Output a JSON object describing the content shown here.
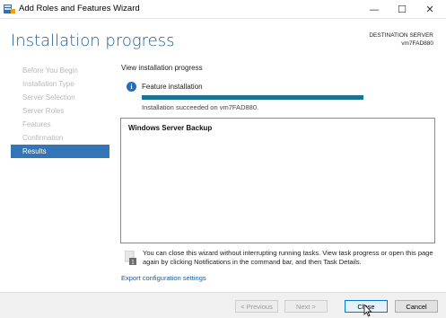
{
  "window": {
    "title": "Add Roles and Features Wizard",
    "controls": {
      "minimize": "—",
      "maximize": "☐",
      "close": "✕"
    }
  },
  "header": {
    "page_title": "Installation progress",
    "destination_label": "DESTINATION SERVER",
    "destination_server": "vm7FAD880"
  },
  "sidebar": {
    "items": [
      {
        "label": "Before You Begin",
        "active": false
      },
      {
        "label": "Installation Type",
        "active": false
      },
      {
        "label": "Server Selection",
        "active": false
      },
      {
        "label": "Server Roles",
        "active": false
      },
      {
        "label": "Features",
        "active": false
      },
      {
        "label": "Confirmation",
        "active": false
      },
      {
        "label": "Results",
        "active": true
      }
    ]
  },
  "main": {
    "section_label": "View installation progress",
    "feature_label": "Feature installation",
    "progress_fraction": 1.0,
    "result_text": "Installation succeeded on vm7FAD880.",
    "results_items": [
      "Windows Server Backup"
    ],
    "note": "You can close this wizard without interrupting running tasks. View task progress or open this page again by clicking Notifications in the command bar, and then Task Details.",
    "export_link": "Export configuration settings"
  },
  "footer": {
    "previous": "< Previous",
    "next": "Next >",
    "close": "Close",
    "cancel": "Cancel"
  },
  "colors": {
    "accent": "#3276b7",
    "title_blue": "#1a5a96",
    "progress": "#1a7592"
  }
}
